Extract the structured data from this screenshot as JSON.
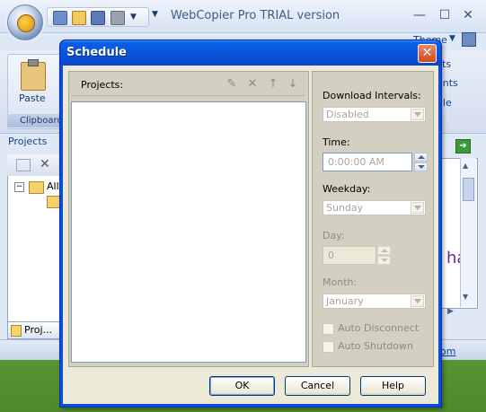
{
  "app": {
    "title": "WebCopier Pro TRIAL version",
    "theme_label": "Theme",
    "window_buttons": {
      "minimize": "—",
      "maximize": "☐",
      "close": "✕"
    },
    "ribbon": {
      "paste_label": "Paste",
      "clipboard_group": "Clipboard",
      "right_items": [
        "cts",
        "ents",
        "file"
      ]
    },
    "left_pane": {
      "header": "Projects",
      "tree_root": "All",
      "tab_label": "Proj..."
    },
    "right_pane_text": "ha",
    "status_link": "om"
  },
  "dialog": {
    "title": "Schedule",
    "projects_label": "Projects:",
    "projects": [],
    "download_intervals": {
      "label": "Download Intervals:",
      "value": "Disabled"
    },
    "time": {
      "label": "Time:",
      "value": "0:00:00 AM"
    },
    "weekday": {
      "label": "Weekday:",
      "value": "Sunday"
    },
    "day": {
      "label": "Day:",
      "value": "0"
    },
    "month": {
      "label": "Month:",
      "value": "January"
    },
    "auto_disconnect": {
      "label": "Auto Disconnect",
      "checked": false
    },
    "auto_shutdown": {
      "label": "Auto Shutdown",
      "checked": false
    },
    "buttons": {
      "ok": "OK",
      "cancel": "Cancel",
      "help": "Help"
    },
    "close_glyph": "✕"
  },
  "colors": {
    "dialog_title_bar": "#0a52d8",
    "dialog_body": "#ece9d8",
    "panel": "#d3d0c1",
    "disabled_text": "#8d8b80"
  }
}
